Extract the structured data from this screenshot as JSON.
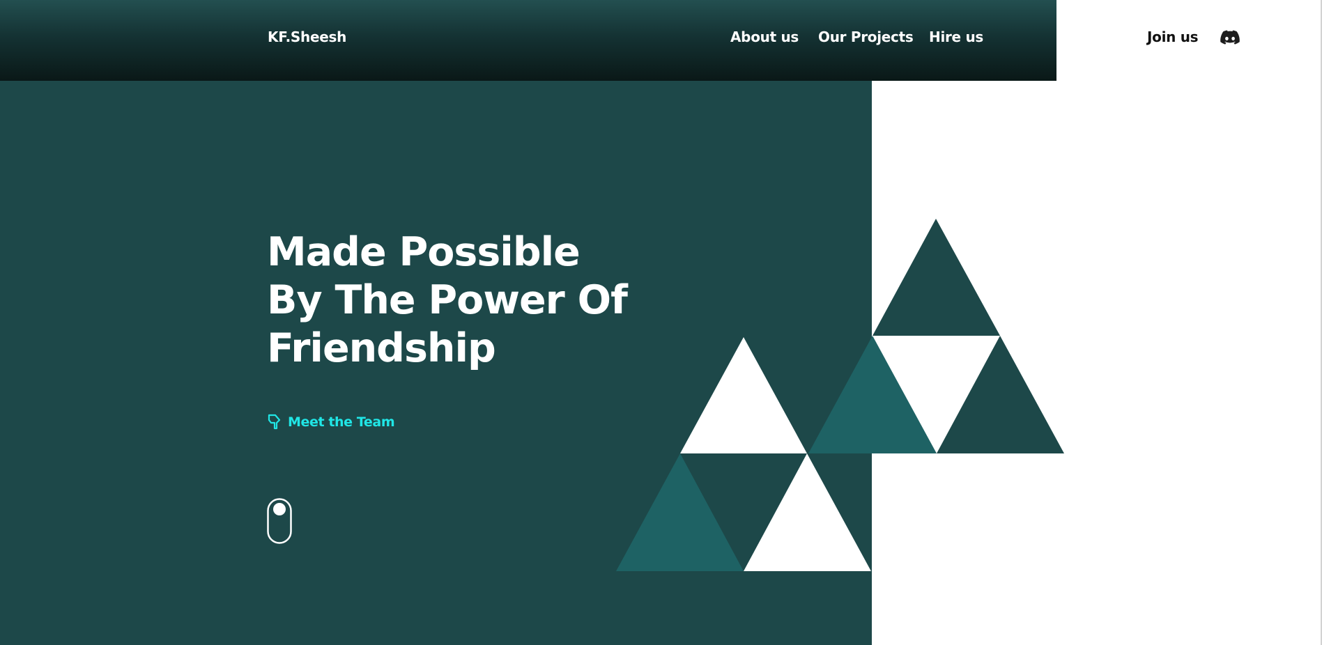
{
  "brand": {
    "name": "KF.Sheesh"
  },
  "nav": {
    "links": [
      {
        "label": "About us"
      },
      {
        "label": "Our Projects"
      },
      {
        "label": "Hire us"
      }
    ],
    "join_label": "Join us",
    "discord_icon": "discord-icon"
  },
  "hero": {
    "headline_lines": [
      "Made Possible",
      "By The Power Of",
      "Friendship"
    ],
    "cta_label": "Meet the Team",
    "cta_icon": "pointing-hand-icon",
    "scroll_icon": "mouse-scroll-icon"
  },
  "colors": {
    "hero_bg": "#1d4849",
    "nav_dark": "#0a1817",
    "accent": "#20e6e6",
    "triangle_teal": "#1e6264",
    "triangle_dark": "#1d4849",
    "triangle_white": "#ffffff"
  }
}
